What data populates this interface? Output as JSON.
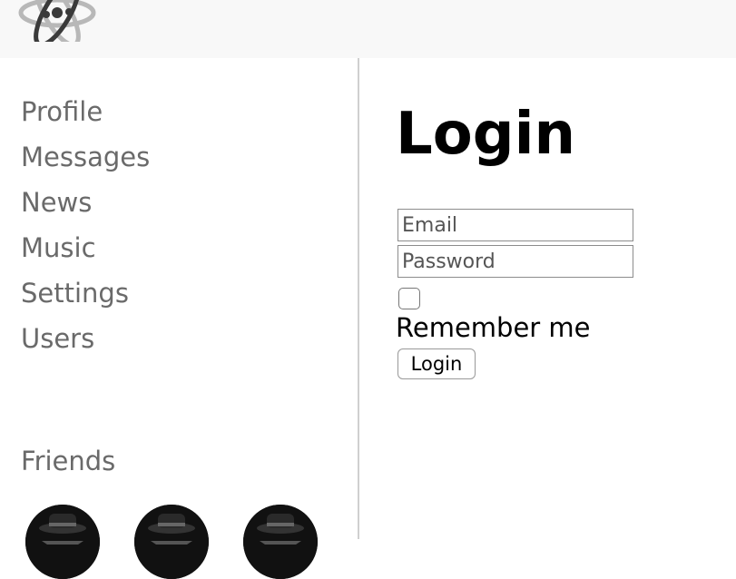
{
  "header": {
    "logo_icon": "atom-logo-icon"
  },
  "sidebar": {
    "items": [
      {
        "label": "Profile"
      },
      {
        "label": "Messages"
      },
      {
        "label": "News"
      },
      {
        "label": "Music"
      },
      {
        "label": "Settings"
      },
      {
        "label": "Users"
      }
    ],
    "friends_title": "Friends",
    "friends_count_shown": 3
  },
  "login": {
    "title": "Login",
    "email_placeholder": "Email",
    "password_placeholder": "Password",
    "remember_label": "Remember me",
    "submit_label": "Login"
  },
  "colors": {
    "header_bg": "#f8f8f8",
    "nav_text": "#6a6a6a",
    "divider": "#cfcfcf"
  }
}
